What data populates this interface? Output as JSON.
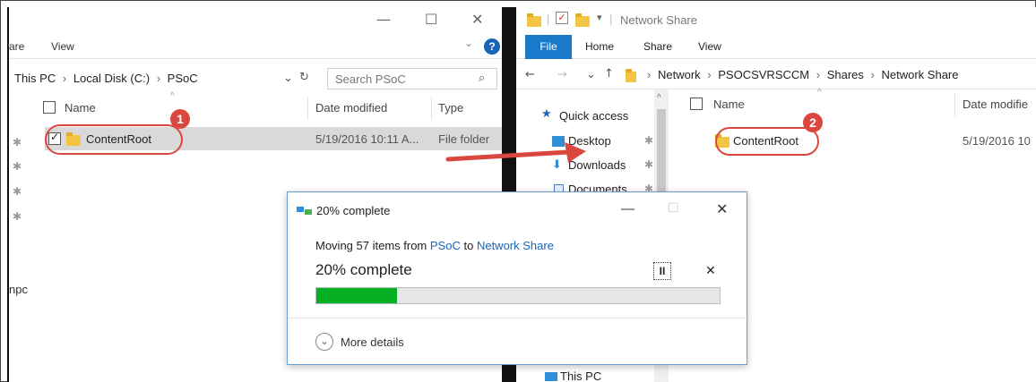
{
  "left_window": {
    "ribbon_tabs": [
      "are",
      "View"
    ],
    "address": [
      "This PC",
      "Local Disk (C:)",
      "PSoC"
    ],
    "search_placeholder": "Search PSoC",
    "columns": {
      "name": "Name",
      "date": "Date modified",
      "type": "Type"
    },
    "rows": [
      {
        "name": "ContentRoot",
        "date": "5/19/2016 10:11 A...",
        "type": "File folder"
      }
    ],
    "sidebar_fragment": "npc",
    "callout_badge": "1"
  },
  "right_window": {
    "title": "Network Share",
    "ribbon_tabs": {
      "file": "File",
      "home": "Home",
      "share": "Share",
      "view": "View"
    },
    "address": [
      "Network",
      "PSOCSVRSCCM",
      "Shares",
      "Network Share"
    ],
    "nav": {
      "quick_access": "Quick access",
      "desktop": "Desktop",
      "downloads": "Downloads",
      "documents": "Documents",
      "this_pc": "This PC"
    },
    "columns": {
      "name": "Name",
      "date": "Date modifie"
    },
    "rows": [
      {
        "name": "ContentRoot",
        "date": "5/19/2016 10"
      }
    ],
    "callout_badge": "2"
  },
  "dialog": {
    "title": "20% complete",
    "moving_prefix": "Moving 57 items from",
    "source": "PSoC",
    "to_word": "to",
    "destination": "Network Share",
    "status": "20% complete",
    "progress": 0.2,
    "more_details": "More details",
    "pause_label": "II",
    "cancel_label": "✕"
  },
  "colors": {
    "accent": "#1a64b8",
    "progress_fill": "#06b025",
    "callout_red": "#d9473e",
    "arrow_red": "#d9473e"
  }
}
